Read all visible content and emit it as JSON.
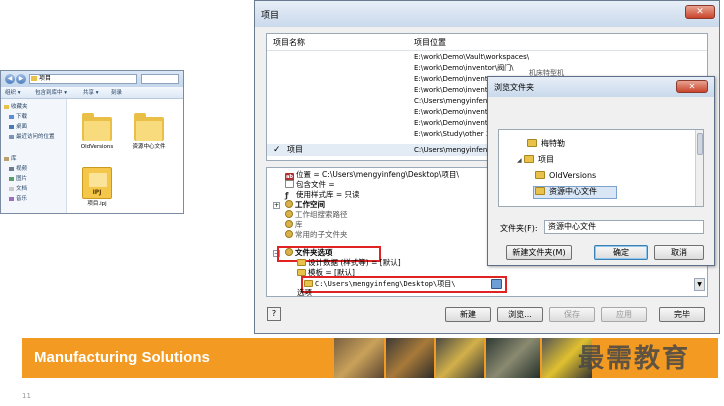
{
  "explorer": {
    "path_segment": "项目",
    "toolbar": [
      "组织 ▾",
      "包含到库中 ▾",
      "共享 ▾",
      "刻录"
    ],
    "nav_items": [
      {
        "label": "收藏夹",
        "icon": "star-icon"
      },
      {
        "label": "下载",
        "icon": "download-icon"
      },
      {
        "label": "桌面",
        "icon": "desktop-icon"
      },
      {
        "label": "最近访问的位置",
        "icon": "recent-icon"
      },
      {
        "label": "库",
        "icon": "library-icon"
      },
      {
        "label": "视频",
        "icon": "video-icon"
      },
      {
        "label": "图片",
        "icon": "picture-icon"
      },
      {
        "label": "文档",
        "icon": "document-icon"
      },
      {
        "label": "音乐",
        "icon": "music-icon"
      }
    ],
    "files": [
      {
        "name": "OldVersions",
        "type": "folder"
      },
      {
        "name": "资源中心文件",
        "type": "folder"
      },
      {
        "name": "项目.ipj",
        "type": "ipj",
        "icon_text": "IPJ"
      }
    ]
  },
  "main_dialog": {
    "title": "项目",
    "close_glyph": "✕",
    "columns": {
      "name": "项目名称",
      "location": "项目位置"
    },
    "paths": [
      "E:\\work\\Demo\\Vault\\workspaces\\",
      "E:\\work\\Demo\\inventor\\阀门\\",
      "E:\\work\\Demo\\inventor",
      "E:\\work\\Demo\\inventor",
      "C:\\Users\\mengyinfeng",
      "E:\\work\\Demo\\inventor",
      "E:\\work\\Demo\\inventor",
      "E:\\work\\Study\\other 3"
    ],
    "partial_text": "机床特型机",
    "selected_row": {
      "check": "✓",
      "name": "项目",
      "location": "C:\\Users\\mengyinfeng\\Desktop\\项目\\"
    },
    "tree": [
      "位置 = C:\\Users\\mengyinfeng\\Desktop\\项目\\",
      "包含文件 =",
      "使用样式库 = 只读",
      "工作空间",
      "工作组搜索路径",
      "库",
      "常用的子文件夹",
      "文件夹选项",
      "设计数据 (样式等) = [默认]",
      "模板 = [默认]",
      "选项"
    ],
    "path_field_value": "C:\\Users\\mengyinfeng\\Desktop\\项目\\",
    "help_label": "?",
    "buttons": [
      "新建",
      "浏览...",
      "保存",
      "应用",
      "完毕"
    ]
  },
  "browse_dialog": {
    "title": "浏览文件夹",
    "close_glyph": "✕",
    "tree": [
      "梅特勒",
      "项目",
      "OldVersions",
      "资源中心文件"
    ],
    "folder_label": "文件夹(F):",
    "folder_value": "资源中心文件",
    "buttons": {
      "new_folder": "新建文件夹(M)",
      "ok": "确定",
      "cancel": "取消"
    }
  },
  "footer": {
    "title": "Manufacturing Solutions",
    "page_number": "11",
    "watermark": "最需教育",
    "accent": "#f29a21"
  }
}
